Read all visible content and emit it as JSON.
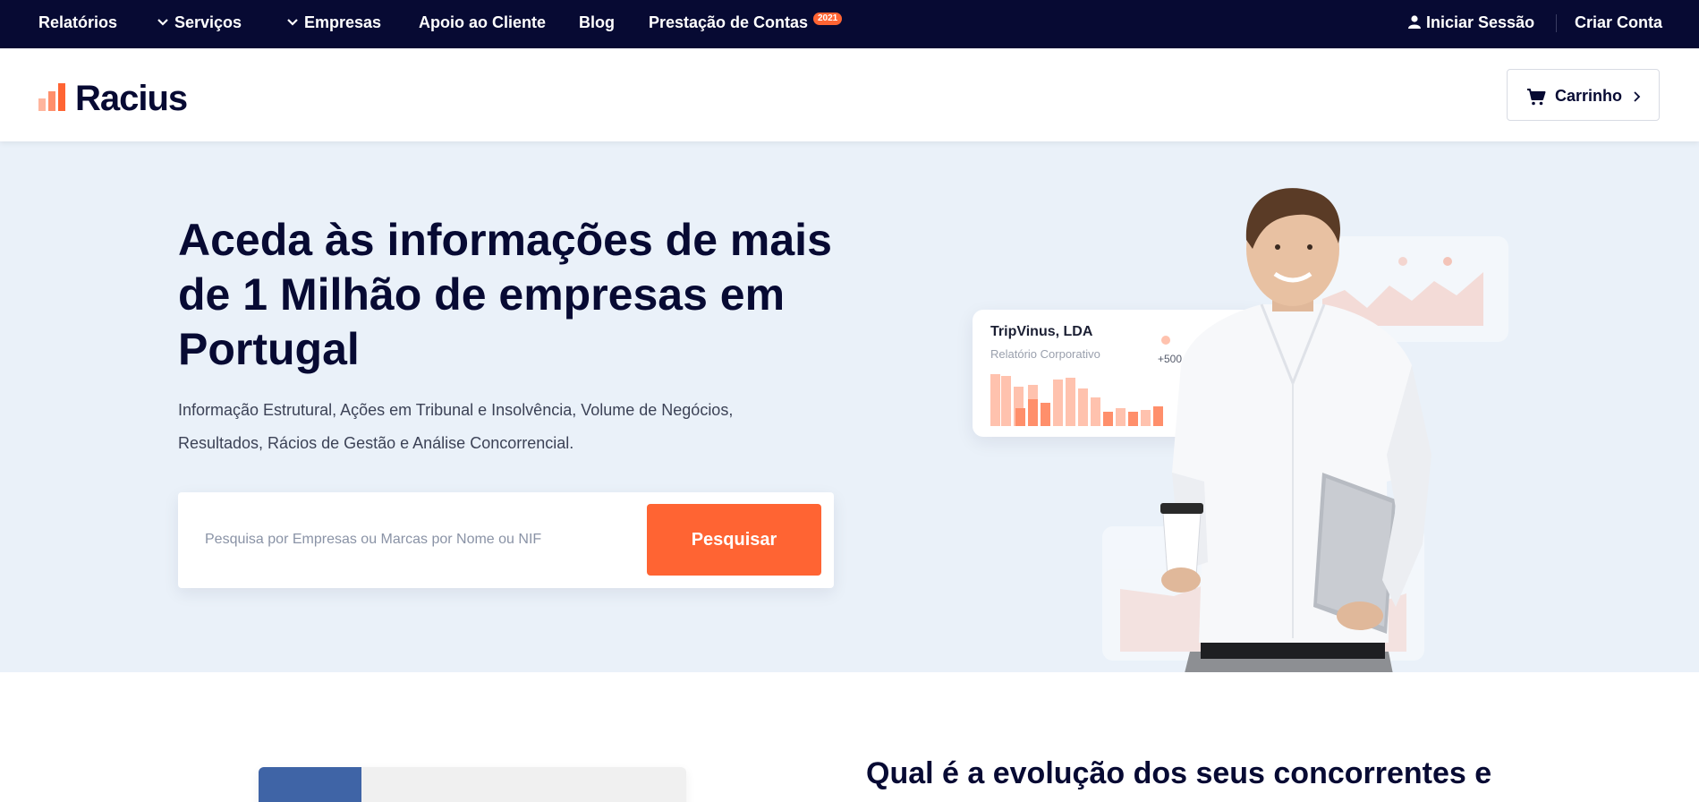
{
  "topnav": {
    "relatorios": "Relatórios",
    "servicos": "Serviços",
    "empresas": "Empresas",
    "apoio": "Apoio ao Cliente",
    "blog": "Blog",
    "prestacao": "Prestação de Contas",
    "prestacao_badge": "2021",
    "login": "Iniciar Sessão",
    "register": "Criar Conta"
  },
  "header": {
    "logo_text": "Racius",
    "cart_label": "Carrinho"
  },
  "hero": {
    "title": "Aceda às informações de mais de 1 Milhão de empresas em Portugal",
    "subtitle": "Informação Estrutural, Ações em Tribunal e Insolvência, Volume de Negócios, Resultados, Rácios de Gestão e Análise Concorrencial.",
    "search_placeholder": "Pesquisa por Empresas ou Marcas por Nome ou NIF",
    "search_button": "Pesquisar",
    "card_company": "TripVinus, LDA",
    "card_report": "Relatório Corporativo",
    "card_count": "+500"
  },
  "section2": {
    "title": "Qual é a evolução dos seus concorrentes e"
  },
  "colors": {
    "navy": "#070a33",
    "accent": "#ff6433",
    "hero_bg": "#eaf1f9"
  },
  "icons": [
    "chevron-down-icon",
    "user-icon",
    "cart-icon",
    "chevron-right-icon"
  ]
}
